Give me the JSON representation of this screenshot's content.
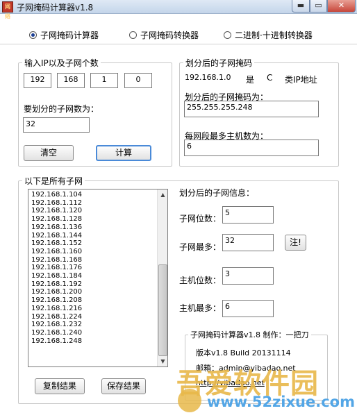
{
  "window": {
    "title": "子网掩码计算器v1.8",
    "icon_text": "网络",
    "minimize_glyph": "▬",
    "maximize_glyph": "▭",
    "close_glyph": "✕"
  },
  "tabs": [
    {
      "label": "子网掩码计算器",
      "checked": true
    },
    {
      "label": "子网掩码转换器",
      "checked": false
    },
    {
      "label": "二进制·十进制转换器",
      "checked": false
    }
  ],
  "input_group": {
    "legend": "输入IP以及子网个数",
    "ip": [
      "192",
      "168",
      "1",
      "0"
    ],
    "subnet_count_label": "要划分的子网数为：",
    "subnet_count": "32",
    "clear_label": "清空",
    "calc_label": "计算"
  },
  "result_group": {
    "legend": "划分后的子网掩码",
    "ip_text": "192.168.1.0",
    "is_text": "是",
    "class_letter": "C",
    "class_text": "类IP地址",
    "mask_label": "划分后的子网掩码为：",
    "mask_value": "255.255.255.248",
    "max_hosts_label": "每网段最多主机数为：",
    "max_hosts_value": "6"
  },
  "subnets_group": {
    "legend": "以下是所有子网",
    "items": [
      "192.168.1.104",
      "192.168.1.112",
      "192.168.1.120",
      "192.168.1.128",
      "192.168.1.136",
      "192.168.1.144",
      "192.168.1.152",
      "192.168.1.160",
      "192.168.1.168",
      "192.168.1.176",
      "192.168.1.184",
      "192.168.1.192",
      "192.168.1.200",
      "192.168.1.208",
      "192.168.1.216",
      "192.168.1.224",
      "192.168.1.232",
      "192.168.1.240",
      "192.168.1.248"
    ],
    "scroll_up": "▲",
    "scroll_down": "▼",
    "copy_label": "复制结果",
    "save_label": "保存结果"
  },
  "subnet_info": {
    "heading": "划分后的子网信息：",
    "subnet_bits_label": "子网位数：",
    "subnet_bits": "5",
    "subnet_max_label": "子网最多：",
    "subnet_max": "32",
    "note_label": "注!",
    "host_bits_label": "主机位数：",
    "host_bits": "3",
    "host_max_label": "主机最多：",
    "host_max": "6"
  },
  "about": {
    "legend": "子网掩码计算器v1.8  制作：一把刀",
    "version": "版本v1.8  Build 20131114",
    "email": "邮箱：admin@yibadao.net",
    "url": "http://yibadao.net"
  },
  "watermark": {
    "logo": "吾爱软件园",
    "url": "www.52zixue.com"
  }
}
